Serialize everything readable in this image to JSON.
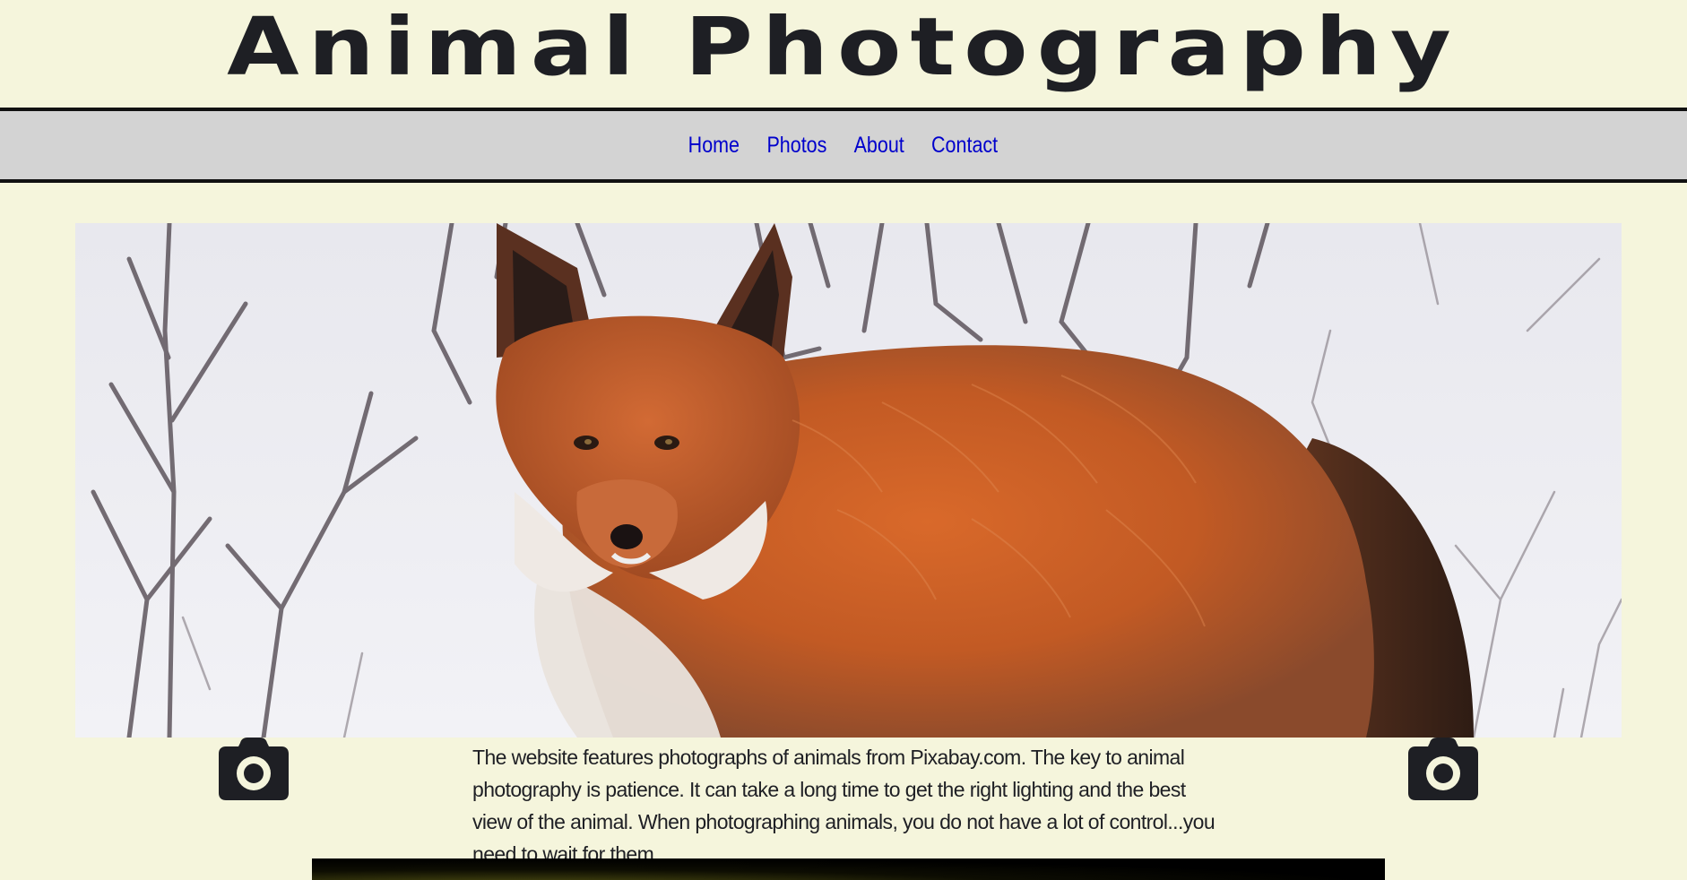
{
  "site": {
    "title": "Animal Photography"
  },
  "nav": {
    "items": [
      {
        "label": "Home"
      },
      {
        "label": "Photos"
      },
      {
        "label": "About"
      },
      {
        "label": "Contact"
      }
    ]
  },
  "hero": {
    "icon": "fox-photo"
  },
  "main": {
    "intro": "The website features photographs of animals from Pixabay.com. The key to animal photography is patience. It can take a long time to get the right lighting and the best view of the animal. When photographing animals, you do not have a lot of control...you need to wait for them.",
    "left_icon": "camera-icon",
    "right_icon": "camera-icon"
  },
  "colors": {
    "page_background": "#f5f5dc",
    "nav_background": "#d3d3d3",
    "link": "#0000cc",
    "text": "#1e1f24"
  }
}
